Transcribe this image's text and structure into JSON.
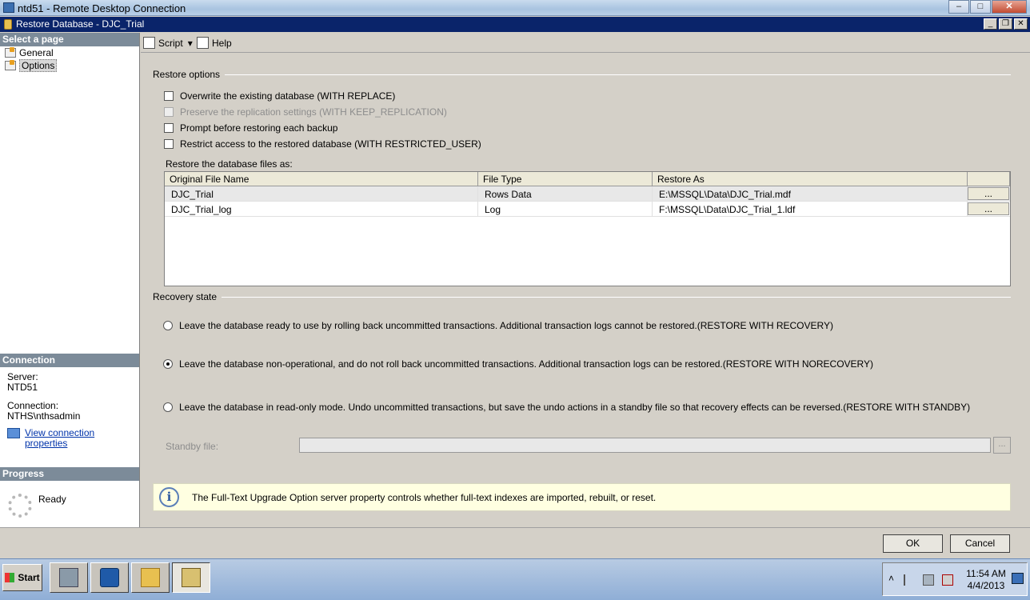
{
  "rdp": {
    "title": "ntd51 - Remote Desktop Connection",
    "min": "–",
    "max": "□",
    "close": "✕"
  },
  "window": {
    "title": "Restore Database - DJC_Trial",
    "min": "_",
    "max": "❐",
    "close": "✕"
  },
  "left": {
    "select_header": "Select a page",
    "pages": [
      "General",
      "Options"
    ],
    "selected_page": "Options",
    "connection_header": "Connection",
    "server_label": "Server:",
    "server": "NTD51",
    "connection_label": "Connection:",
    "connection": "NTHS\\nthsadmin",
    "view_props": "View connection properties",
    "progress_header": "Progress",
    "progress_status": "Ready"
  },
  "toolbar": {
    "script": "Script",
    "script_arrow": "▾",
    "help": "Help"
  },
  "restore_options": {
    "header": "Restore options",
    "checks": [
      {
        "label": "Overwrite the existing database (WITH REPLACE)",
        "checked": false,
        "enabled": true
      },
      {
        "label": "Preserve the replication settings (WITH KEEP_REPLICATION)",
        "checked": false,
        "enabled": false
      },
      {
        "label": "Prompt before restoring each backup",
        "checked": false,
        "enabled": true
      },
      {
        "label": "Restrict access to the restored database (WITH RESTRICTED_USER)",
        "checked": false,
        "enabled": true
      }
    ],
    "files_label": "Restore the database files as:",
    "columns": [
      "Original File Name",
      "File Type",
      "Restore As",
      ""
    ],
    "rows": [
      {
        "name": "DJC_Trial",
        "type": "Rows Data",
        "restore_as": "E:\\MSSQL\\Data\\DJC_Trial.mdf",
        "btn": "..."
      },
      {
        "name": "DJC_Trial_log",
        "type": "Log",
        "restore_as": "F:\\MSSQL\\Data\\DJC_Trial_1.ldf",
        "btn": "..."
      }
    ]
  },
  "recovery": {
    "header": "Recovery state",
    "options": [
      {
        "label": "Leave the database ready to use by rolling back uncommitted transactions. Additional transaction logs cannot be restored.(RESTORE WITH RECOVERY)",
        "selected": false
      },
      {
        "label": "Leave the database non-operational, and do not roll back uncommitted transactions. Additional transaction logs can be restored.(RESTORE WITH NORECOVERY)",
        "selected": true
      },
      {
        "label": "Leave the database in read-only mode. Undo uncommitted transactions, but save the undo actions in a standby file so that recovery effects can be reversed.(RESTORE WITH STANDBY)",
        "selected": false
      }
    ],
    "standby_label": "Standby file:",
    "standby_value": "",
    "standby_btn": "..."
  },
  "info": {
    "icon": "i",
    "text": "The Full-Text Upgrade Option server property controls whether full-text indexes are imported, rebuilt, or reset."
  },
  "footer": {
    "ok": "OK",
    "cancel": "Cancel"
  },
  "taskbar": {
    "start": "Start",
    "tray_arrow": "˄",
    "time": "11:54 AM",
    "date": "4/4/2013"
  },
  "colors": {
    "title_bar": "#0a246a",
    "pane_header": "#7c8b99",
    "info_bg": "#ffffe1",
    "link": "#0033aa"
  }
}
